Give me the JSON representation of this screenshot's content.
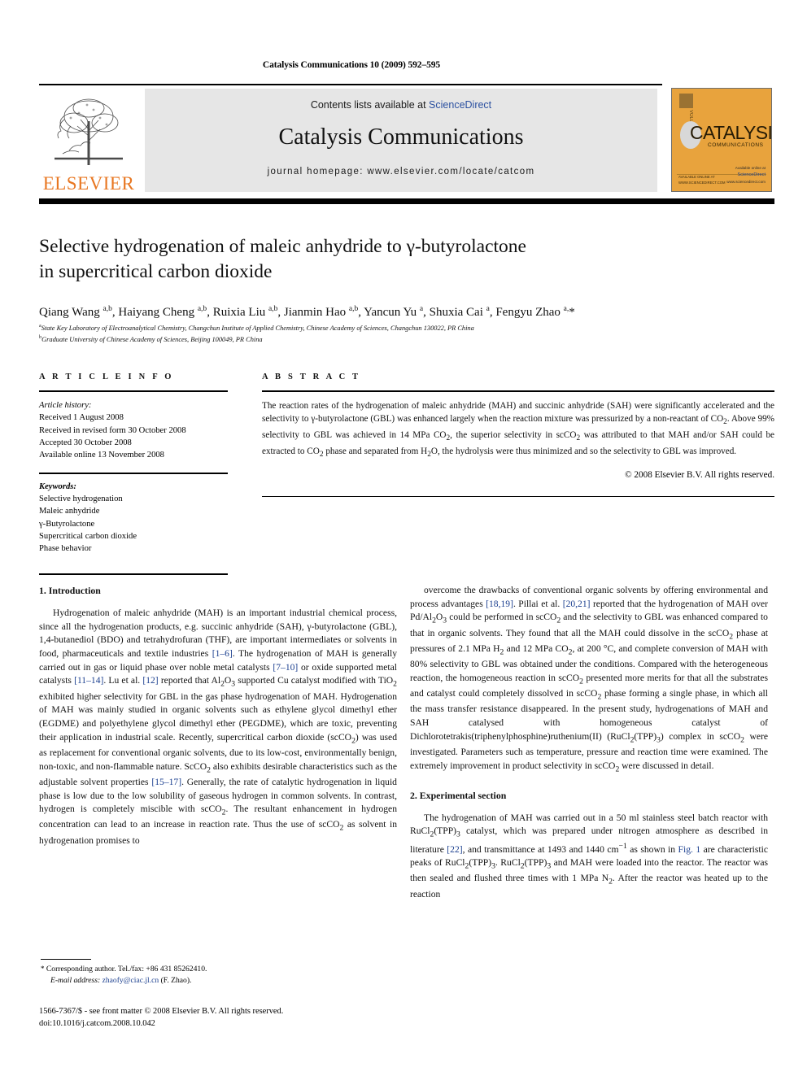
{
  "running_head": "Catalysis Communications 10 (2009) 592–595",
  "masthead": {
    "publisher_logo_text": "ELSEVIER",
    "contents_prefix": "Contents lists available at",
    "contents_link": "ScienceDirect",
    "journal_title": "Catalysis Communications",
    "homepage_line": "journal homepage: www.elsevier.com/locate/catcom",
    "cover": {
      "word": "CATALYSIS",
      "sub": "COMMUNICATIONS",
      "spine": "VOLUME 10",
      "foot_left": "AVAILABLE ONLINE AT WWW.SCIENCEDIRECT.COM",
      "foot_right_top": "Available online at",
      "foot_right_link": "ScienceDirect",
      "foot_right_url": "www.sciencedirect.com",
      "accent_color": "#E8A33D"
    }
  },
  "article": {
    "title_line1": "Selective hydrogenation of maleic anhydride to γ-butyrolactone",
    "title_line2": "in supercritical carbon dioxide",
    "authors_html": "Qiang Wang <sup>a,b</sup>, Haiyang Cheng <sup>a,b</sup>, Ruixia Liu <sup>a,b</sup>, Jianmin Hao <sup>a,b</sup>, Yancun Yu <sup>a</sup>, Shuxia Cai <sup>a</sup>, Fengyu Zhao <sup>a,</sup>*",
    "affiliation_a": "State Key Laboratory of Electroanalytical Chemistry, Changchun Institute of Applied Chemistry, Chinese Academy of Sciences, Changchun 130022, PR China",
    "affiliation_b": "Graduate University of Chinese Academy of Sciences, Beijing 100049, PR China"
  },
  "article_info": {
    "heading": "A R T I C L E   I N F O",
    "history_label": "Article history:",
    "history": [
      "Received 1 August 2008",
      "Received in revised form 30 October 2008",
      "Accepted 30 October 2008",
      "Available online 13 November 2008"
    ],
    "keywords_label": "Keywords:",
    "keywords": [
      "Selective hydrogenation",
      "Maleic anhydride",
      "γ-Butyrolactone",
      "Supercritical carbon dioxide",
      "Phase behavior"
    ]
  },
  "abstract": {
    "heading": "A B S T R A C T",
    "body_html": "The reaction rates of the hydrogenation of maleic anhydride (MAH) and succinic anhydride (SAH) were significantly accelerated and the selectivity to γ-butyrolactone (GBL) was enhanced largely when the reaction mixture was pressurized by a non-reactant of CO<sub>2</sub>. Above 99% selectivity to GBL was achieved in 14&nbsp;MPa CO<sub>2</sub>, the superior selectivity in scCO<sub>2</sub> was attributed to that MAH and/or SAH could be extracted to CO<sub>2</sub> phase and separated from H<sub>2</sub>O, the hydrolysis were thus minimized and so the selectivity to GBL was improved.",
    "copyright": "© 2008 Elsevier B.V. All rights reserved."
  },
  "body": {
    "section1_heading": "1. Introduction",
    "section1_p1_html": "Hydrogenation of maleic anhydride (MAH) is an important industrial chemical process, since all the hydrogenation products, e.g. succinic anhydride (SAH), γ-butyrolactone (GBL), 1,4-butanediol (BDO) and tetrahydrofuran (THF), are important intermediates or solvents in food, pharmaceuticals and textile industries <span class=\"ref\">[1–6]</span>. The hydrogenation of MAH is generally carried out in gas or liquid phase over noble metal catalysts <span class=\"ref\">[7–10]</span> or oxide supported metal catalysts <span class=\"ref\">[11–14]</span>. Lu et al. <span class=\"ref\">[12]</span> reported that Al<sub>2</sub>O<sub>3</sub> supported Cu catalyst modified with TiO<sub>2</sub> exhibited higher selectivity for GBL in the gas phase hydrogenation of MAH. Hydrogenation of MAH was mainly studied in organic solvents such as ethylene glycol dimethyl ether (EGDME) and polyethylene glycol dimethyl ether (PEGDME), which are toxic, preventing their application in industrial scale. Recently, supercritical carbon dioxide (scCO<sub>2</sub>) was used as replacement for conventional organic solvents, due to its low-cost, environmentally benign, non-toxic, and non-flammable nature. ScCO<sub>2</sub> also exhibits desirable characteristics such as the adjustable solvent properties <span class=\"ref\">[15–17]</span>. Generally, the rate of catalytic hydrogenation in liquid phase is low due to the low solubility of gaseous hydrogen in common solvents. In contrast, hydrogen is completely miscible with scCO<sub>2</sub>. The resultant enhancement in hydrogen concentration can lead to an increase in reaction rate. Thus the use of scCO<sub>2</sub> as solvent in hydrogenation promises to",
    "section1_p1_cont_html": "overcome the drawbacks of conventional organic solvents by offering environmental and process advantages <span class=\"ref\">[18,19]</span>. Pillai et al. <span class=\"ref\">[20,21]</span> reported that the hydrogenation of MAH over Pd/Al<sub>2</sub>O<sub>3</sub> could be performed in scCO<sub>2</sub> and the selectivity to GBL was enhanced compared to that in organic solvents. They found that all the MAH could dissolve in the scCO<sub>2</sub> phase at pressures of 2.1&nbsp;MPa H<sub>2</sub> and 12&nbsp;MPa CO<sub>2</sub>, at 200&nbsp;°C, and complete conversion of MAH with 80% selectivity to GBL was obtained under the conditions. Compared with the heterogeneous reaction, the homogeneous reaction in scCO<sub>2</sub> presented more merits for that all the substrates and catalyst could completely dissolved in scCO<sub>2</sub> phase forming a single phase, in which all the mass transfer resistance disappeared. In the present study, hydrogenations of MAH and SAH catalysed with homogeneous catalyst of Dichlorotetrakis(triphenylphosphine)ruthenium(II) (RuCl<sub>2</sub>(TPP)<sub>3</sub>) complex in scCO<sub>2</sub> were investigated. Parameters such as temperature, pressure and reaction time were examined. The extremely improvement in product selectivity in scCO<sub>2</sub> were discussed in detail.",
    "section2_heading": "2. Experimental section",
    "section2_p1_html": "The hydrogenation of MAH was carried out in a 50&nbsp;ml stainless steel batch reactor with RuCl<sub>2</sub>(TPP)<sub>3</sub> catalyst, which was prepared under nitrogen atmosphere as described in literature <span class=\"ref\">[22]</span>, and transmittance at 1493 and 1440&nbsp;cm<sup>−1</sup> as shown in <span class=\"ref\">Fig. 1</span> are characteristic peaks of RuCl<sub>2</sub>(TPP)<sub>3</sub>. RuCl<sub>2</sub>(TPP)<sub>3</sub> and MAH were loaded into the reactor. The reactor was then sealed and flushed three times with 1&nbsp;MPa N<sub>2</sub>. After the reactor was heated up to the reaction"
  },
  "footnote": {
    "star": "*",
    "corresponding": "Corresponding author. Tel./fax: +86 431 85262410.",
    "email_label": "E-mail address:",
    "email": "zhaofy@ciac.jl.cn",
    "email_suffix": "(F. Zhao)."
  },
  "footer": {
    "line1": "1566-7367/$ - see front matter © 2008 Elsevier B.V. All rights reserved.",
    "line2": "doi:10.1016/j.catcom.2008.10.042"
  }
}
